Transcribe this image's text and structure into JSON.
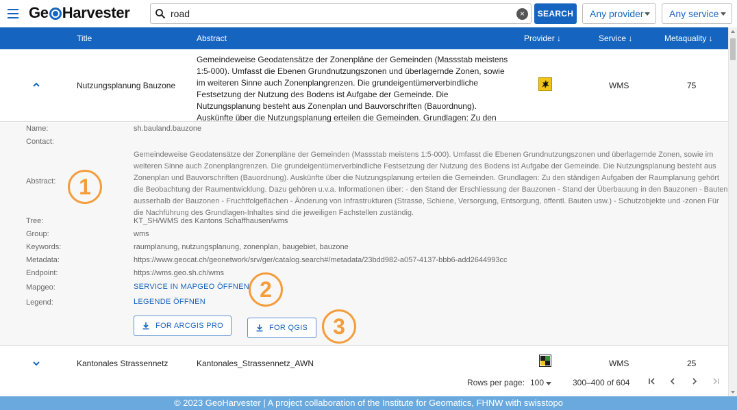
{
  "app": {
    "logo_left": "Ge",
    "logo_right": "Harvester"
  },
  "search": {
    "value": "road",
    "button_label": "SEARCH"
  },
  "filters": {
    "provider": "Any provider",
    "service": "Any service"
  },
  "table": {
    "headers": {
      "title": "Title",
      "abstract": "Abstract",
      "provider": "Provider ↓",
      "service": "Service ↓",
      "metaquality": "Metaquality ↓"
    },
    "rows": [
      {
        "title": "Nutzungsplanung Bauzone",
        "abstract": "Gemeindeweise Geodatensätze der Zonenpläne der Gemeinden (Massstab meistens 1:5-000). Umfasst die Ebenen Grundnutzungszonen und überlagernde Zonen, sowie im weiteren Sinne auch Zonenplangrenzen. Die grundeigentümerverbindliche Festsetzung der Nutzung des Bodens ist Aufgabe der Gemeinde. Die Nutzungsplanung besteht aus Zonenplan und Bauvorschriften (Bauordnung). Auskünfte über die Nutzungsplanung erteilen die Gemeinden. Grundlagen: Zu den ständig...",
        "service": "WMS",
        "metaquality": "75",
        "provider_icon": "schaffhausen-ram-icon",
        "expanded": true
      },
      {
        "title": "Kantonales Strassennetz",
        "abstract": "Kantonales_Strassennetz_AWN",
        "service": "WMS",
        "metaquality": "25",
        "provider_icon": "canton-logo-icon",
        "expanded": false
      }
    ]
  },
  "detail": {
    "labels": {
      "name": "Name:",
      "contact": "Contact:",
      "abstract": "Abstract:",
      "tree": "Tree:",
      "group": "Group:",
      "keywords": "Keywords:",
      "metadata": "Metadata:",
      "endpoint": "Endpoint:",
      "mapgeo": "Mapgeo:",
      "legend": "Legend:"
    },
    "name": "sh.bauland.bauzone",
    "contact": "",
    "abstract": "Gemeindeweise Geodatensätze der Zonenpläne der Gemeinden (Massstab meistens 1:5-000). Umfasst die Ebenen Grundnutzungszonen und überlagernde Zonen, sowie im weiteren Sinne auch Zonenplangrenzen. Die grundeigentümerverbindliche Festsetzung der Nutzung des Bodens ist Aufgabe der Gemeinde. Die Nutzungsplanung besteht aus Zonenplan und Bauvorschriften (Bauordnung). Auskünfte über die Nutzungsplanung erteilen die Gemeinden. Grundlagen: Zu den ständigen Aufgaben der Raumplanung gehört die Beobachtung der Raumentwicklung. Dazu gehören u.v.a. Informationen über: - den Stand der Erschliessung der Bauzonen - Stand der Überbauung in den Bauzonen - Bauten ausserhalb der Bauzonen - Fruchtfolgeflächen - Änderung von Infrastrukturen (Strasse, Schiene, Versorgung, Entsorgung, öffentl. Bauten usw.) - Schutzobjekte und -zonen Für die Nachführung des Grundlagen-Inhaltes sind die jeweiligen Fachstellen zuständig.",
    "tree": "KT_SH/WMS des Kantons Schaffhausen/wms",
    "group": "wms",
    "keywords": "raumplanung, nutzungsplanung, zonenplan, baugebiet, bauzone",
    "metadata": "https://www.geocat.ch/geonetwork/srv/ger/catalog.search#/metadata/23bdd982-a057-4137-bbb6-add2644993cc",
    "endpoint": "https://wms.geo.sh.ch/wms",
    "mapgeo_link": "SERVICE IN MAPGEO ÖFFNEN",
    "legend_link": "LEGENDE ÖFFNEN",
    "arcgis_button": "FOR ARCGIS PRO",
    "qgis_button": "FOR QGIS"
  },
  "markers": [
    "1",
    "2",
    "3"
  ],
  "pagination": {
    "rows_per_page_label": "Rows per page:",
    "rows_per_page": "100",
    "range": "300–400 of 604"
  },
  "footer": {
    "text": "© 2023 GeoHarvester | A project collaboration of the Institute for Geomatics, FHNW with swisstopo"
  },
  "colors": {
    "primary": "#1565c0",
    "marker": "#f59c3b",
    "footer": "#6aa9dd",
    "detail_bg": "#f7f7f7"
  }
}
